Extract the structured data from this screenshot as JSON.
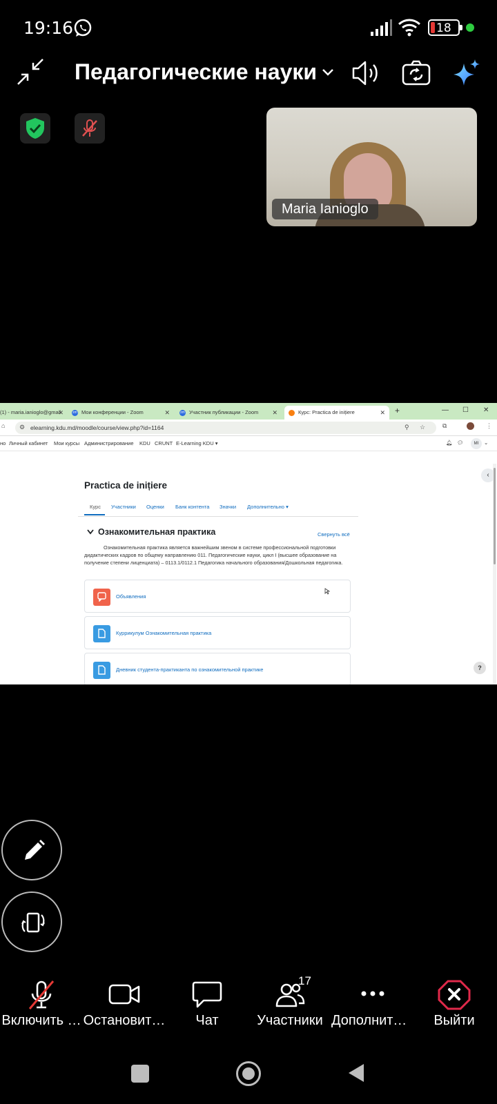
{
  "status_bar": {
    "time": "19:16",
    "battery": "18"
  },
  "meeting": {
    "title": "Педагогические науки"
  },
  "video": {
    "participant_name": "Maria Ianioglo"
  },
  "shared_screen": {
    "browser": {
      "tabs": [
        {
          "label": "(1) - maria.ianioglo@gmail",
          "icon": "mail-icon"
        },
        {
          "label": "Мои конференции - Zoom",
          "icon": "zoom-icon"
        },
        {
          "label": "Участник публикации - Zoom",
          "icon": "zoom-icon"
        },
        {
          "label": "Курс: Practica de inițiere",
          "icon": "moodle-icon"
        }
      ],
      "url": "elearning.kdu.md/moodle/course/view.php?id=1164"
    },
    "nav": {
      "items": [
        "но",
        "Личный кабинет",
        "Мои курсы",
        "Администрирование",
        "KDU",
        "CRUNT",
        "E-Learning KDU ▾"
      ],
      "user_initials": "MI"
    },
    "course": {
      "title": "Practica de inițiere",
      "tabs": [
        "Курс",
        "Участники",
        "Оценки",
        "Банк контента",
        "Значки",
        "Дополнительно ▾"
      ],
      "section_title": "Ознакомительная практика",
      "collapse_all": "Свернуть всё",
      "description": "Ознакомительная практика является важнейшим звеном в системе профессиональной подготовки дидактических кадров по общему направлению 011. Педагогические науки, цикл I (высшее образование на получение степени лиценциата) – 0113.1/0112.1 Педагогика начального образования/Дошкольная педагогика.",
      "activities": [
        {
          "label": "Объявления",
          "color": "#f0634b"
        },
        {
          "label": "Куррикулум Ознакомительная практика",
          "color": "#399be2"
        },
        {
          "label": "Дневник студента-практиканта по ознакомительной практике",
          "color": "#399be2"
        }
      ]
    }
  },
  "toolbar": {
    "mic_label": "Включить …",
    "video_label": "Остановит…",
    "chat_label": "Чат",
    "participants_label": "Участники",
    "participants_count": "17",
    "more_label": "Дополните…",
    "leave_label": "Выйти"
  }
}
